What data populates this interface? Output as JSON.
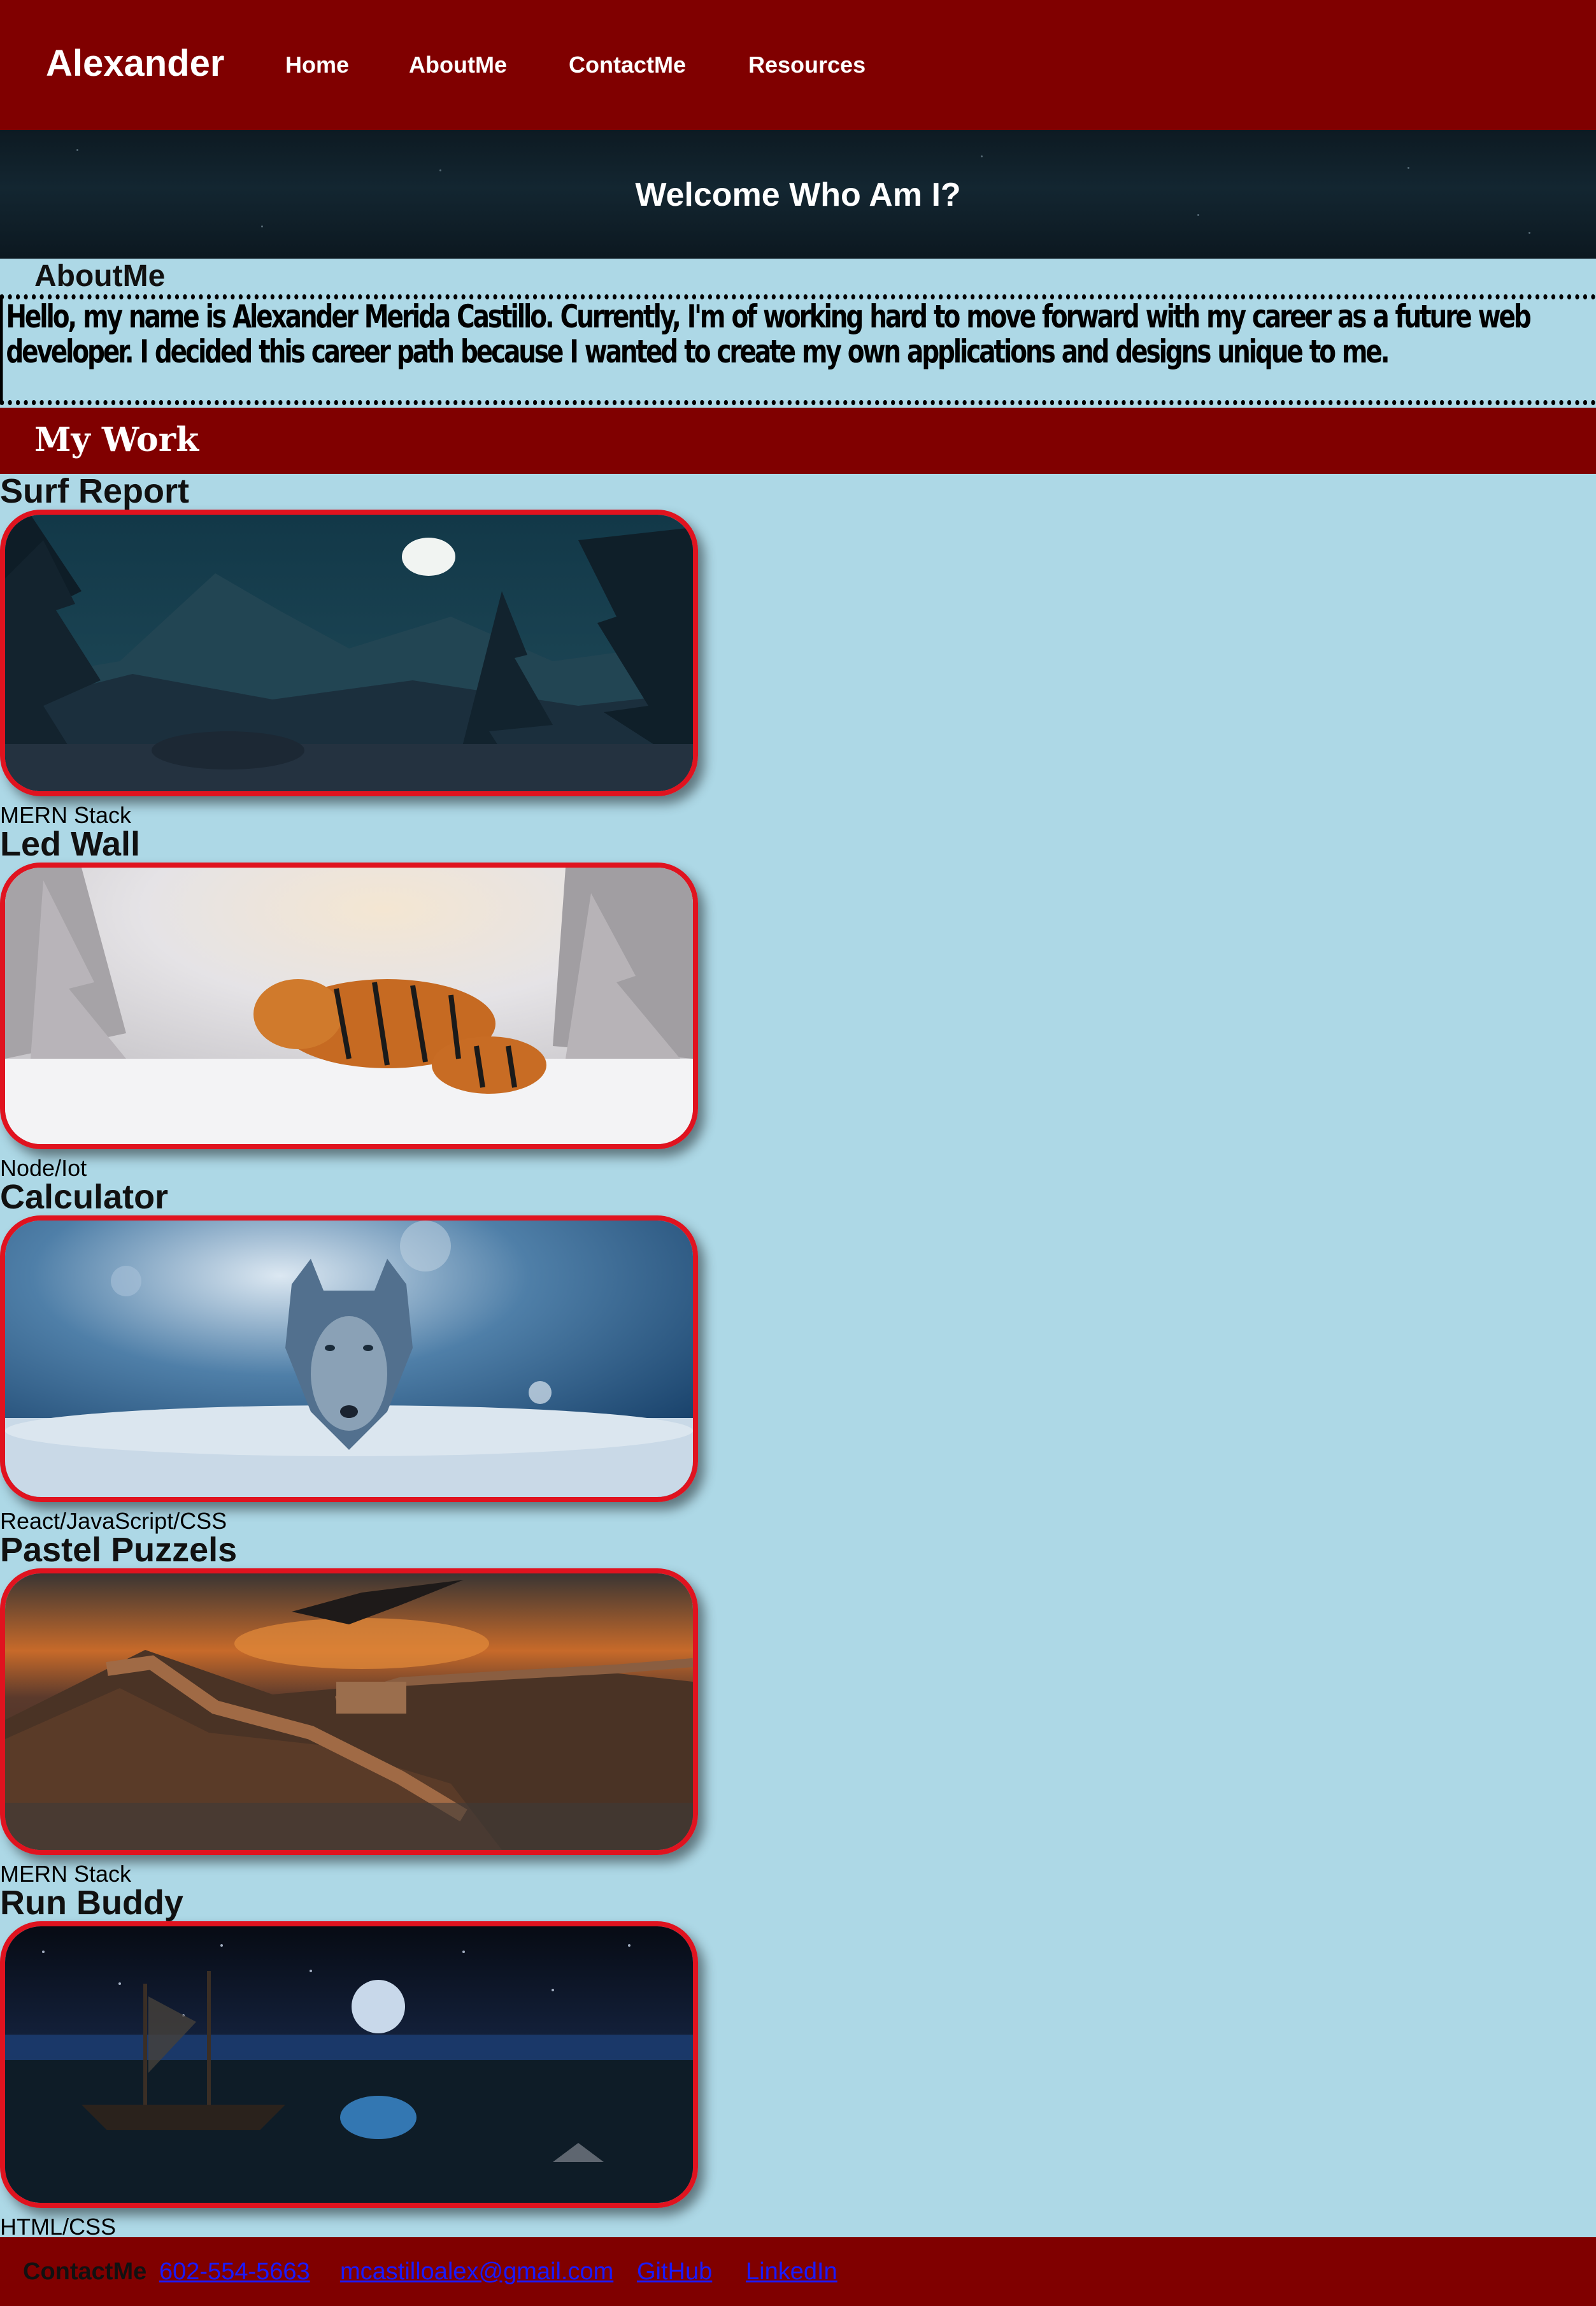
{
  "header": {
    "brand": "Alexander",
    "nav": [
      "Home",
      "AboutMe",
      "ContactMe",
      "Resources"
    ]
  },
  "hero": {
    "title": "Welcome Who Am I?"
  },
  "about": {
    "heading": "AboutMe",
    "text": "Hello, my name is Alexander Merida Castillo. Currently, I'm of working hard to move forward with my career as a future web developer. I decided this career path because I wanted to create my own applications and designs unique to me."
  },
  "work": {
    "title": "My Work",
    "projects": [
      {
        "title": "Surf Report",
        "stack": "MERN Stack",
        "image": "night-forest-moon-image"
      },
      {
        "title": "Led Wall",
        "stack": "Node/Iot",
        "image": "tigers-in-snow-image"
      },
      {
        "title": "Calculator",
        "stack": "React/JavaScript/CSS",
        "image": "wolf-in-snow-image"
      },
      {
        "title": "Pastel Puzzels",
        "stack": "MERN Stack",
        "image": "great-wall-dragon-image"
      },
      {
        "title": "Run Buddy",
        "stack": "HTML/CSS",
        "image": "pirate-ship-moon-sea-image"
      }
    ]
  },
  "footer": {
    "label": "ContactMe",
    "links": [
      "602-554-5663",
      "mcastilloalex@gmail.com",
      "GitHub",
      "LinkedIn"
    ]
  },
  "colors": {
    "header_bg": "#800000",
    "page_bg": "#add8e6",
    "image_border": "#e0131f",
    "link": "#1a1aff"
  }
}
